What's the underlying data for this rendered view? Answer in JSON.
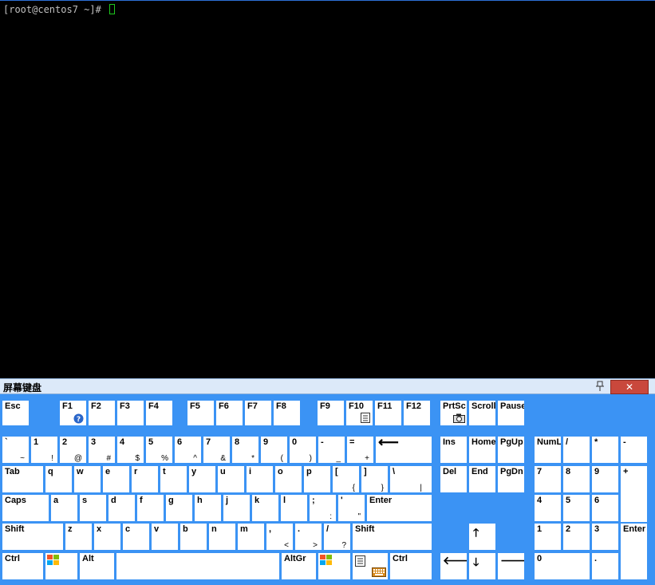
{
  "terminal": {
    "prompt": "[root@centos7 ~]# "
  },
  "osk": {
    "title": "屏幕键盘",
    "close": "✕",
    "colors": {
      "panel": "#3b93f4",
      "key": "#ffffff",
      "close": "#c9483c"
    }
  },
  "keys": {
    "esc": "Esc",
    "f1": "F1",
    "f2": "F2",
    "f3": "F3",
    "f4": "F4",
    "f5": "F5",
    "f6": "F6",
    "f7": "F7",
    "f8": "F8",
    "f9": "F9",
    "f10": "F10",
    "f11": "F11",
    "f12": "F12",
    "prtsc": "PrtSc",
    "scroll": "Scroll",
    "pause": "Pause",
    "backtick": "`",
    "backtick_s": "~",
    "k1": "1",
    "k1_s": "!",
    "k2": "2",
    "k2_s": "@",
    "k3": "3",
    "k3_s": "#",
    "k4": "4",
    "k4_s": "$",
    "k5": "5",
    "k5_s": "%",
    "k6": "6",
    "k6_s": "^",
    "k7": "7",
    "k7_s": "&",
    "k8": "8",
    "k8_s": "*",
    "k9": "9",
    "k9_s": "(",
    "k0": "0",
    "k0_s": ")",
    "minus": "-",
    "minus_s": "_",
    "equal": "=",
    "equal_s": "+",
    "backspace": "⟵",
    "tab": "Tab",
    "q": "q",
    "w": "w",
    "e": "e",
    "r": "r",
    "t": "t",
    "y": "y",
    "u": "u",
    "i": "i",
    "o": "o",
    "p": "p",
    "lbracket": "[",
    "lbracket_s": "{",
    "rbracket": "]",
    "rbracket_s": "}",
    "backslash": "\\",
    "backslash_s": "|",
    "caps": "Caps",
    "a": "a",
    "s": "s",
    "d": "d",
    "f": "f",
    "g": "g",
    "h": "h",
    "j": "j",
    "k": "k",
    "l": "l",
    "semicolon": ";",
    "semicolon_s": ":",
    "quote": "'",
    "quote_s": "\"",
    "enter": "Enter",
    "shift": "Shift",
    "z": "z",
    "x": "x",
    "c": "c",
    "v": "v",
    "b": "b",
    "n": "n",
    "m": "m",
    "comma": ",",
    "comma_s": "<",
    "period": ".",
    "period_s": ">",
    "slash": "/",
    "slash_s": "?",
    "rshift": "Shift",
    "ctrl": "Ctrl",
    "alt": "Alt",
    "altgr": "AltGr",
    "rctrl": "Ctrl",
    "ins": "Ins",
    "home": "Home",
    "pgup": "PgUp",
    "del": "Del",
    "end": "End",
    "pgdn": "PgDn",
    "up": "🡑",
    "left": "🡐",
    "down": "🡓",
    "right": "🡒",
    "numl": "NumL",
    "ndiv": "/",
    "nmul": "*",
    "nsub": "-",
    "n7": "7",
    "n8": "8",
    "n9": "9",
    "nadd": "+",
    "n4": "4",
    "n5": "5",
    "n6": "6",
    "n1": "1",
    "n2": "2",
    "n3": "3",
    "nenter": "Enter",
    "n0": "0",
    "ndot": "."
  }
}
